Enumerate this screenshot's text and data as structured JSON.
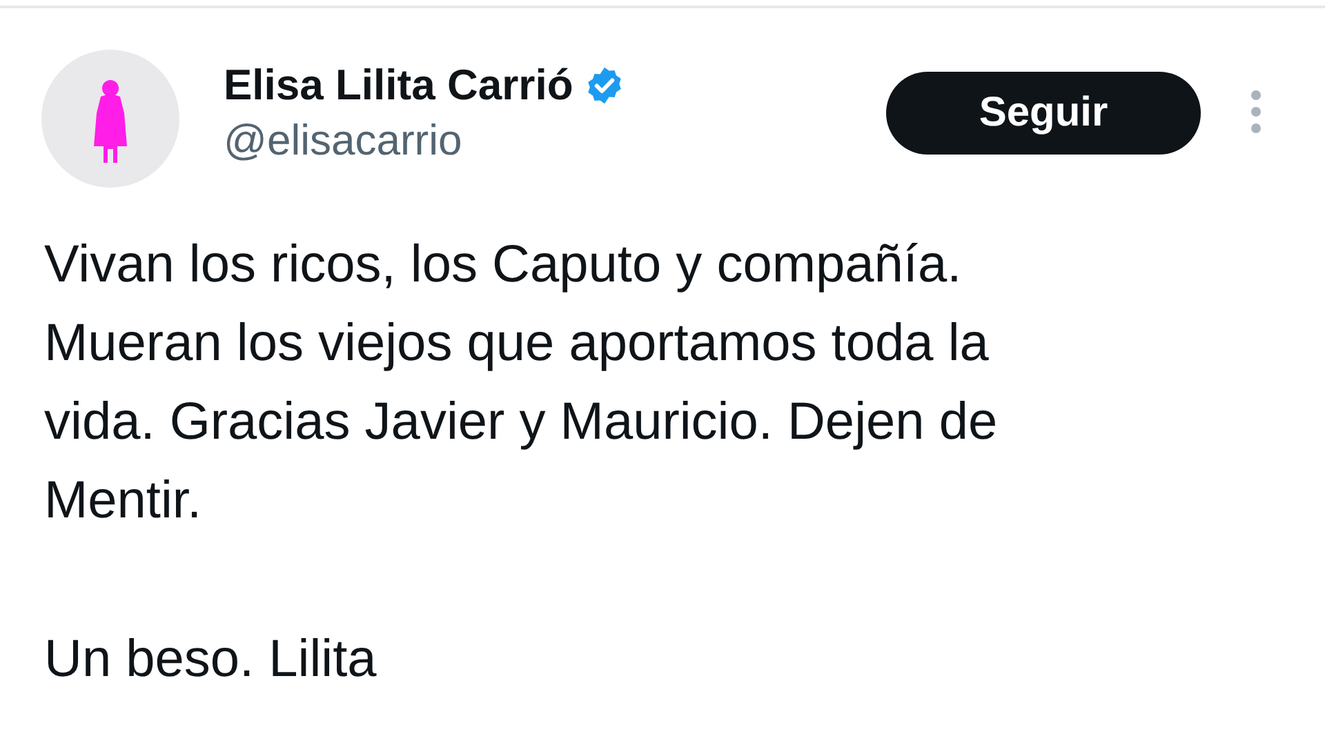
{
  "author": {
    "name": "Elisa Lilita Carrió",
    "verified": true,
    "handle": "@elisacarrio"
  },
  "follow_button": {
    "label": "Seguir"
  },
  "paragraphs": [
    "Vivan los ricos, los Caputo y compañía.\nMueran los viejos que aportamos toda la\nvida. Gracias Javier y Mauricio. Dejen de\nMentir.",
    "Un beso. Lilita"
  ]
}
